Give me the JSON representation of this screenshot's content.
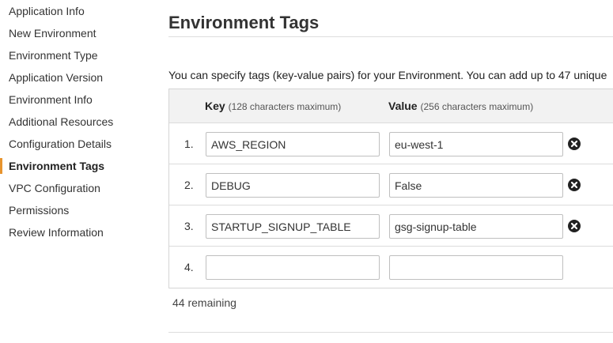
{
  "sidebar": {
    "items": [
      {
        "label": "Application Info",
        "active": false
      },
      {
        "label": "New Environment",
        "active": false
      },
      {
        "label": "Environment Type",
        "active": false
      },
      {
        "label": "Application Version",
        "active": false
      },
      {
        "label": "Environment Info",
        "active": false
      },
      {
        "label": "Additional Resources",
        "active": false
      },
      {
        "label": "Configuration Details",
        "active": false
      },
      {
        "label": "Environment Tags",
        "active": true
      },
      {
        "label": "VPC Configuration",
        "active": false
      },
      {
        "label": "Permissions",
        "active": false
      },
      {
        "label": "Review Information",
        "active": false
      }
    ],
    "active_accent": "#e7942e"
  },
  "main": {
    "title": "Environment Tags",
    "intro": "You can specify tags (key-value pairs) for your Environment. You can add up to 47 unique",
    "table": {
      "key_header": "Key",
      "key_hint": "(128 characters maximum)",
      "value_header": "Value",
      "value_hint": "(256 characters maximum)",
      "rows": [
        {
          "num": "1.",
          "key": "AWS_REGION",
          "value": "eu-west-1",
          "removable": true
        },
        {
          "num": "2.",
          "key": "DEBUG",
          "value": "False",
          "removable": true
        },
        {
          "num": "3.",
          "key": "STARTUP_SIGNUP_TABLE",
          "value": "gsg-signup-table",
          "removable": true
        },
        {
          "num": "4.",
          "key": "",
          "value": "",
          "removable": false
        }
      ]
    },
    "remaining": "44 remaining"
  }
}
